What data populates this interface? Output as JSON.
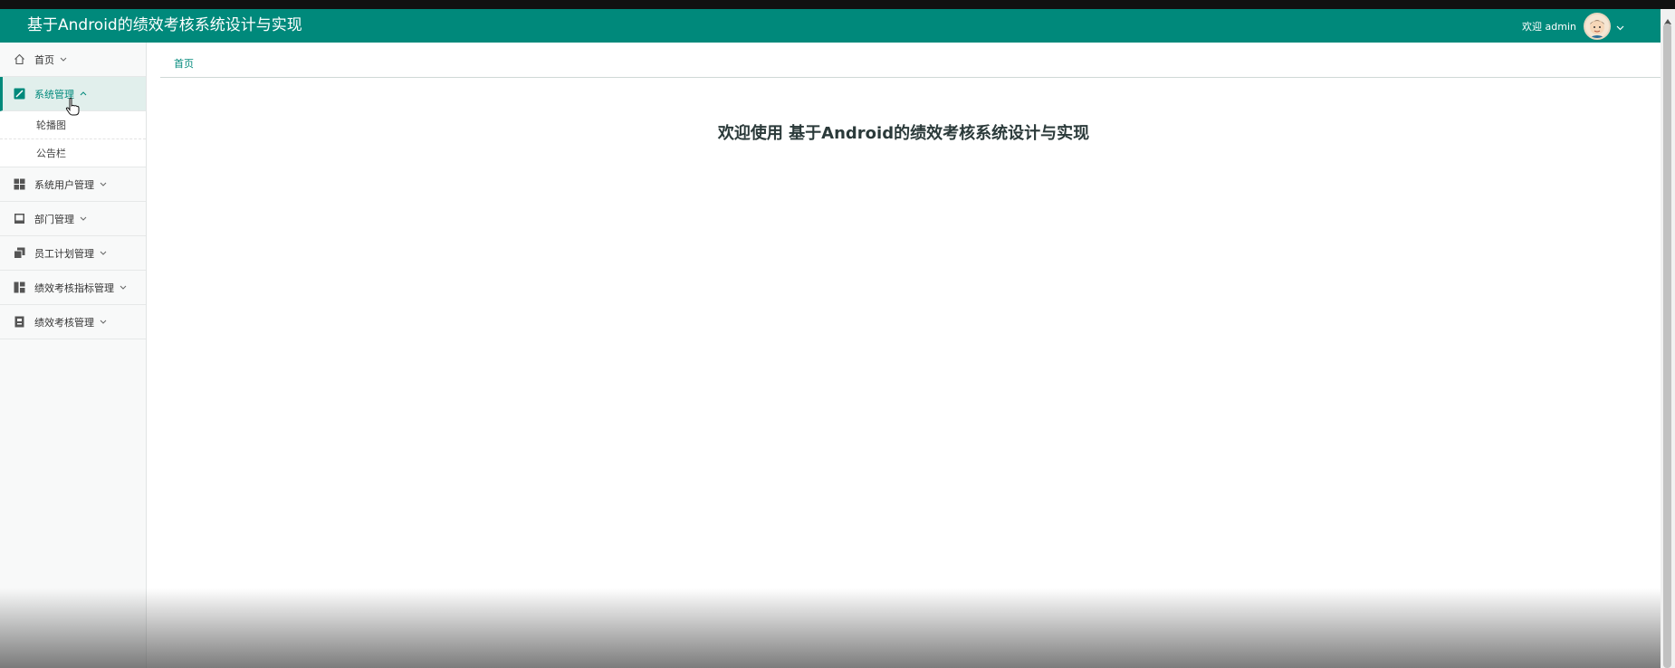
{
  "header": {
    "title": "基于Android的绩效考核系统设计与实现",
    "welcome_user": "欢迎 admin",
    "avatar_icon": "avatar-icon",
    "chevron_icon": "chevron-down-icon"
  },
  "sidebar": {
    "items": [
      {
        "label": "首页",
        "icon": "home-icon",
        "expanded": false
      },
      {
        "label": "系统管理",
        "icon": "system-icon",
        "expanded": true,
        "children": [
          {
            "label": "轮播图"
          },
          {
            "label": "公告栏"
          }
        ]
      },
      {
        "label": "系统用户管理",
        "icon": "grid-icon",
        "expanded": false
      },
      {
        "label": "部门管理",
        "icon": "department-icon",
        "expanded": false
      },
      {
        "label": "员工计划管理",
        "icon": "copy-icon",
        "expanded": false
      },
      {
        "label": "绩效考核指标管理",
        "icon": "dashboard-icon",
        "expanded": false
      },
      {
        "label": "绩效考核管理",
        "icon": "clipboard-icon",
        "expanded": false
      }
    ]
  },
  "breadcrumb": {
    "current": "首页"
  },
  "main": {
    "welcome_heading": "欢迎使用 基于Android的绩效考核系统设计与实现"
  },
  "colors": {
    "accent": "#00897b",
    "active_bg": "#e1efec",
    "sidebar_bg": "#f8f9f9"
  }
}
